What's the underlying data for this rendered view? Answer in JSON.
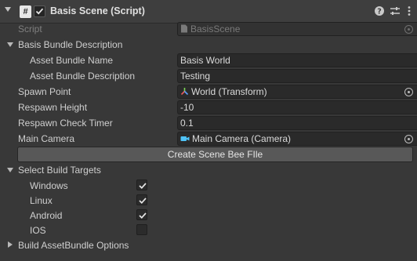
{
  "component": {
    "title": "Basis Scene (Script)",
    "header_icons": [
      "fold-arrow-icon",
      "csharp-script-icon",
      "enable-checkbox",
      "help-icon",
      "presets-icon",
      "more-menu-icon"
    ]
  },
  "script": {
    "label": "Script",
    "value": "BasisScene",
    "icon": "script-file-icon"
  },
  "description_section": {
    "label": "Basis Bundle Description",
    "asset_bundle_name": {
      "label": "Asset Bundle Name",
      "value": "Basis World"
    },
    "asset_bundle_description": {
      "label": "Asset Bundle Description",
      "value": "Testing"
    }
  },
  "spawn_point": {
    "label": "Spawn Point",
    "value": "World (Transform)",
    "icon": "transform-axes-icon"
  },
  "respawn_height": {
    "label": "Respawn Height",
    "value": "-10"
  },
  "respawn_check_timer": {
    "label": "Respawn Check Timer",
    "value": "0.1"
  },
  "main_camera": {
    "label": "Main Camera",
    "value": "Main Camera (Camera)",
    "icon": "camera-icon"
  },
  "create_button": {
    "label": "Create Scene Bee FIle"
  },
  "build_targets": {
    "label": "Select Build Targets",
    "items": [
      {
        "label": "Windows",
        "checked": true
      },
      {
        "label": "Linux",
        "checked": true
      },
      {
        "label": "Android",
        "checked": true
      },
      {
        "label": "IOS",
        "checked": false
      }
    ]
  },
  "build_options": {
    "label": "Build AssetBundle Options"
  },
  "colors": {
    "background": "#383838",
    "field": "#2a2a2a",
    "button": "#585858",
    "header": "#3e3e3e"
  }
}
